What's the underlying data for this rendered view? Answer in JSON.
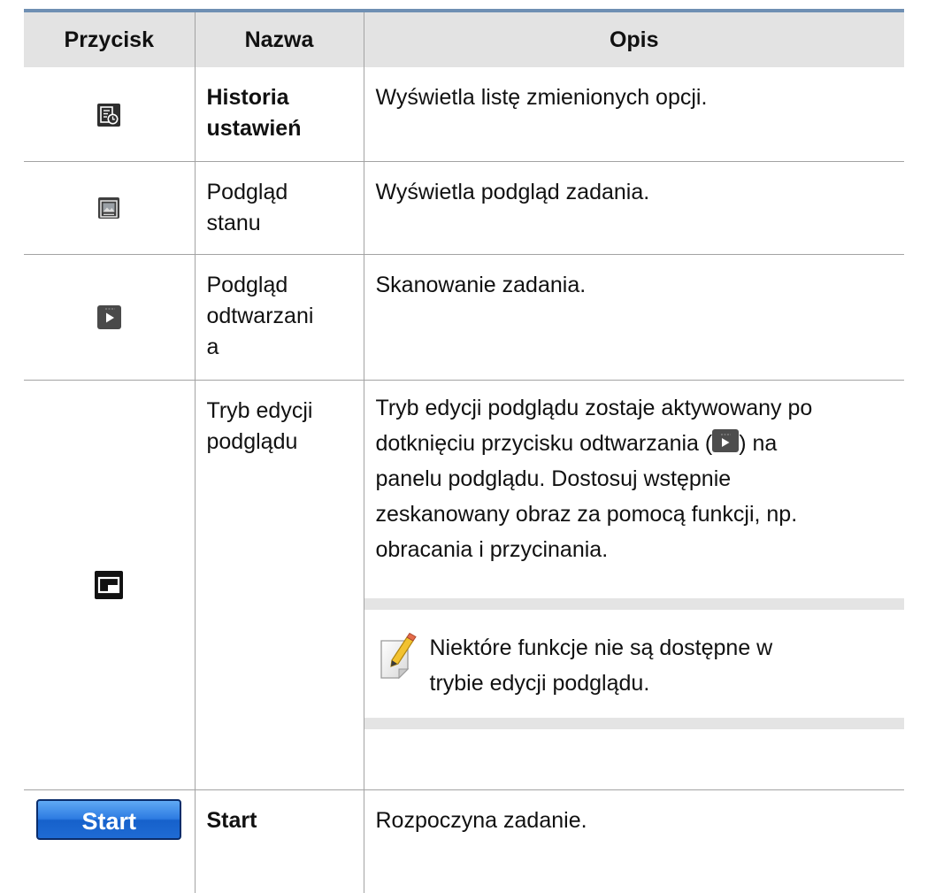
{
  "table": {
    "headers": [
      "Przycisk",
      "Nazwa",
      "Opis"
    ],
    "rows": [
      {
        "icon": "settings-history-icon",
        "name_line1": "Historia",
        "name_line2": "ustawień",
        "name_bold": true,
        "description": "Wyświetla listę zmienionych opcji."
      },
      {
        "icon": "status-preview-icon",
        "name_line1": "Podgląd",
        "name_line2": "stanu",
        "name_bold": false,
        "description": "Wyświetla podgląd zadania."
      },
      {
        "icon": "play-preview-icon",
        "name_line1": "Podgląd",
        "name_line2": "odtwarzani",
        "name_line3": "a",
        "name_bold": false,
        "description": "Skanowanie zadania."
      },
      {
        "icon": "preview-edit-mode-icon",
        "name_line1": "Tryb edycji",
        "name_line2": "podglądu",
        "name_bold": false,
        "description_line1": "Tryb edycji podglądu zostaje aktywowany po",
        "description_line2_before": "dotknięciu przycisku odtwarzania (",
        "description_inline_icon": "play-icon",
        "description_line2_after": ") na",
        "description_line3": "panelu podglądu. Dostosuj wstępnie",
        "description_line4": "zeskanowany obraz za pomocą funkcji, np.",
        "description_line5": "obracania i przycinania.",
        "note": {
          "icon": "note-pencil-icon",
          "line1": "Niektóre funkcje nie są dostępne w",
          "line2": "trybie edycji podglądu."
        }
      },
      {
        "icon": "start-button",
        "button_label": "Start",
        "name_line1": "Start",
        "name_bold": true,
        "description": "Rozpoczyna zadanie."
      }
    ]
  },
  "colors": {
    "header_background": "#e3e3e3",
    "header_top_rule": "#6f8fb3",
    "grid_lines": "#a3a3a3",
    "note_band": "#e4e4e4",
    "start_button": "#2d7be2"
  }
}
